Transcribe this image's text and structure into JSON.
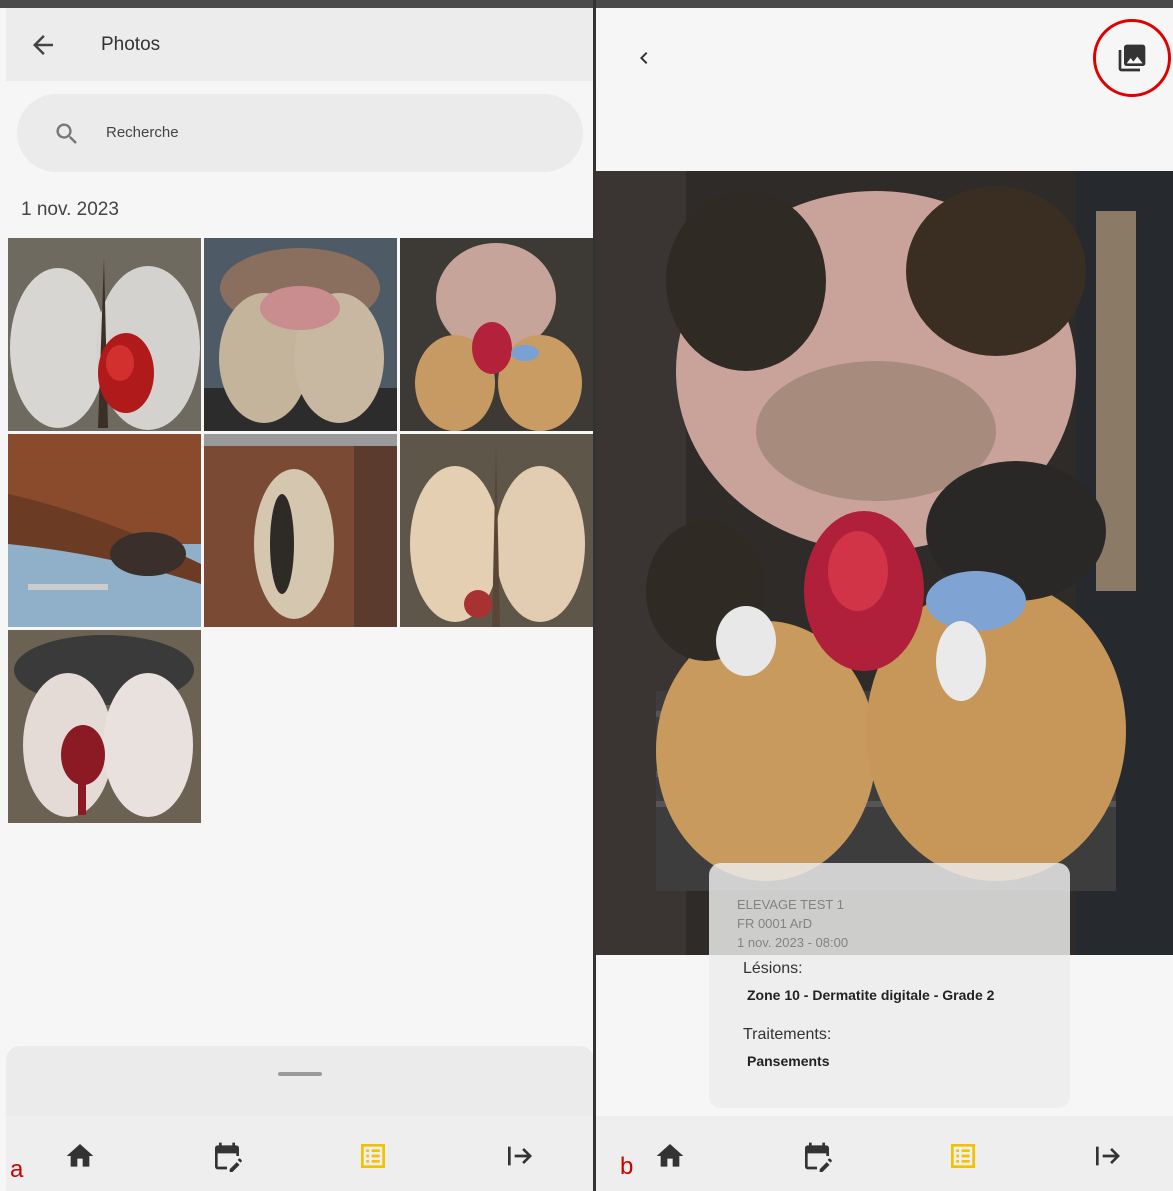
{
  "panel_a": {
    "label": "a",
    "title": "Photos",
    "search": {
      "placeholder": "Recherche"
    },
    "date_header": "1 nov. 2023",
    "photos_count": 7
  },
  "panel_b": {
    "label": "b",
    "overlay": {
      "farm": "ELEVAGE TEST 1",
      "animal": "FR 0001    ArD",
      "datetime": "1 nov. 2023 - 08:00"
    },
    "lesions_label": "Lésions:",
    "lesions_value": "Zone 10 - Dermatite digitale - Grade 2",
    "treatments_label": "Traitements:",
    "treatments_value": "Pansements"
  },
  "bottom_nav": {
    "items": [
      {
        "icon": "home-icon"
      },
      {
        "icon": "calendar-edit-icon"
      },
      {
        "icon": "list-icon",
        "active": true
      },
      {
        "icon": "logout-icon"
      }
    ]
  },
  "colors": {
    "active_nav": "#f2c200",
    "inactive_nav": "#333333",
    "highlight_circle": "#e00000"
  }
}
